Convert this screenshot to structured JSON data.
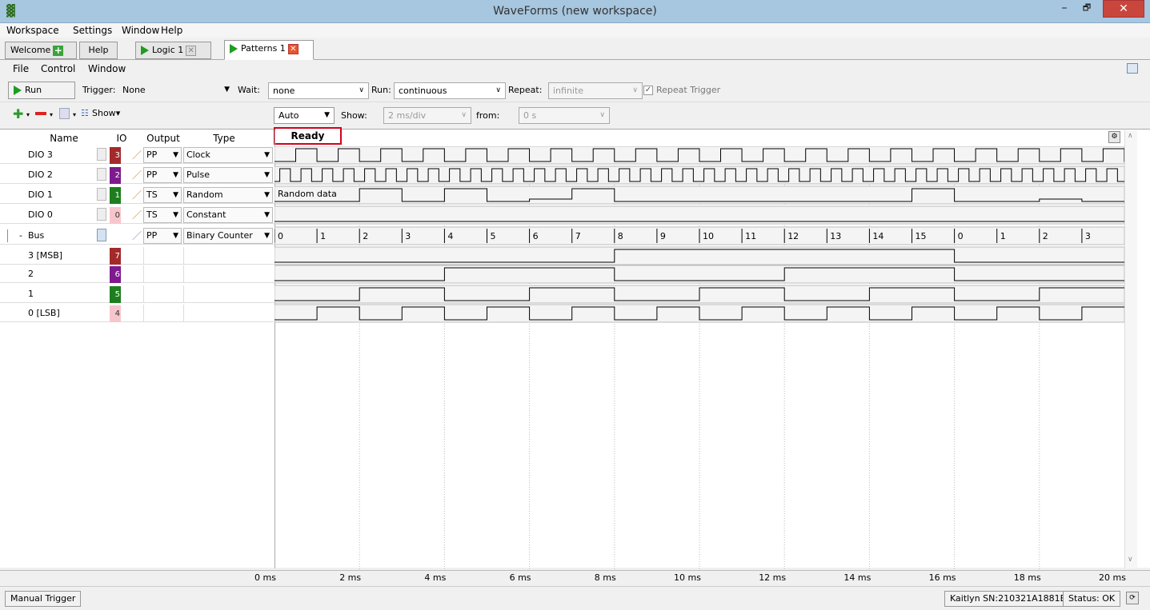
{
  "window": {
    "title": "WaveForms  (new workspace)",
    "minimize": "–",
    "maximize": "🗗",
    "close": "✕"
  },
  "menu": {
    "items": [
      "Workspace",
      "Settings",
      "Window",
      "Help"
    ]
  },
  "tabs": [
    {
      "label": "Welcome",
      "plus": "+"
    },
    {
      "label": "Help"
    },
    {
      "label": "Logic 1",
      "close": "✕"
    },
    {
      "label": "Patterns 1",
      "close": "✕"
    }
  ],
  "submenu": {
    "items": [
      "File",
      "Control",
      "Window"
    ]
  },
  "toolbar": {
    "run_label": "Run",
    "trigger_label": "Trigger:",
    "trigger_value": "None",
    "wait_label": "Wait:",
    "wait_value": "none",
    "run_mode_label": "Run:",
    "run_mode_value": "continuous",
    "repeat_label": "Repeat:",
    "repeat_value": "infinite",
    "repeat_trigger_label": "Repeat Trigger",
    "repeat_trigger_checked": true
  },
  "toolbar2": {
    "show_label": "Show",
    "mode_value": "Auto",
    "show_time_label": "Show:",
    "show_time_value": "2 ms/div",
    "from_label": "from:",
    "from_value": "0 s"
  },
  "status": {
    "state": "Ready"
  },
  "columns": {
    "name": "Name",
    "io": "IO",
    "output": "Output",
    "type": "Type"
  },
  "channels": [
    {
      "name": "DIO 3",
      "io": "3",
      "output": "PP",
      "type": "Clock",
      "color": "#a32a2a"
    },
    {
      "name": "DIO 2",
      "io": "2",
      "output": "PP",
      "type": "Pulse",
      "color": "#7e1a8e"
    },
    {
      "name": "DIO 1",
      "io": "1",
      "output": "TS",
      "type": "Random",
      "color": "#1e7e1e"
    },
    {
      "name": "DIO 0",
      "io": "0",
      "output": "TS",
      "type": "Constant",
      "color": "#f7c6cc"
    },
    {
      "name": "Bus",
      "prefix": "-",
      "output": "PP",
      "type": "Binary Counter"
    },
    {
      "name": "3 [MSB]",
      "io": "7",
      "color": "#a32a2a"
    },
    {
      "name": "2",
      "io": "6",
      "color": "#7e1a8e"
    },
    {
      "name": "1",
      "io": "5",
      "color": "#1e7e1e"
    },
    {
      "name": "0 [LSB]",
      "io": "4",
      "color": "#f7c6cc"
    }
  ],
  "random_data_label": "Random data",
  "bus_values": [
    "0",
    "1",
    "2",
    "3",
    "4",
    "5",
    "6",
    "7",
    "8",
    "9",
    "10",
    "11",
    "12",
    "13",
    "14",
    "15",
    "0",
    "1",
    "2",
    "3"
  ],
  "time_axis": [
    "0 ms",
    "2 ms",
    "4 ms",
    "6 ms",
    "8 ms",
    "10 ms",
    "12 ms",
    "14 ms",
    "16 ms",
    "18 ms",
    "20 ms"
  ],
  "statusbar": {
    "manual_trigger": "Manual Trigger",
    "device": "Kaitlyn SN:210321A1881E",
    "status": "Status: OK"
  }
}
